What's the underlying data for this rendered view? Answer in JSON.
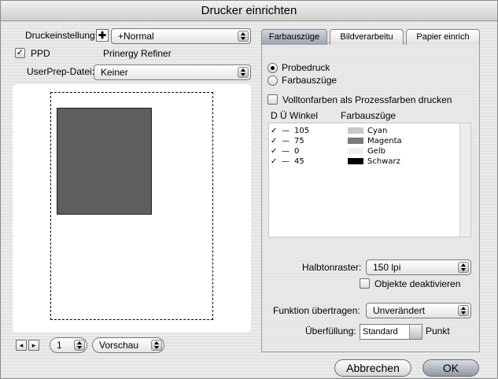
{
  "window": {
    "title": "Drucker einrichten"
  },
  "left": {
    "preset_label": "Druckeinstellung:",
    "preset_value": "+Normal",
    "ppd_label": "PPD",
    "ppd_value": "Prinergy Refiner",
    "userprep_label": "UserPrep-Datei:",
    "userprep_value": "Keiner",
    "page_value": "1",
    "view_value": "Vorschau"
  },
  "tabs": [
    {
      "label": "Farbauszüge"
    },
    {
      "label": "Bildverarbeitu"
    },
    {
      "label": "Papier einrich"
    }
  ],
  "separation": {
    "radio_proof": "Probedruck",
    "radio_sep": "Farbauszüge",
    "spot_checkbox": "Volltonfarben als Prozessfarben drucken",
    "col_headers": "D  Ü  Winkel",
    "col_sep": "Farbauszüge",
    "rows": [
      {
        "check": "✓",
        "dash": "—",
        "angle": "105",
        "name": "Cyan",
        "color": "#c8c8c8"
      },
      {
        "check": "✓",
        "dash": "—",
        "angle": "75",
        "name": "Magenta",
        "color": "#7a7a7a"
      },
      {
        "check": "✓",
        "dash": "—",
        "angle": "0",
        "name": "Gelb",
        "color": "#efefef"
      },
      {
        "check": "✓",
        "dash": "—",
        "angle": "45",
        "name": "Schwarz",
        "color": "#000000"
      }
    ],
    "halftone_label": "Halbtonraster:",
    "halftone_value": "150 lpi",
    "disable_objects": "Objekte deaktivieren",
    "transfer_label": "Funktion übertragen:",
    "transfer_value": "Unverändert",
    "trap_label": "Überfüllung:",
    "trap_value": "Standard",
    "trap_unit": "Punkt"
  },
  "buttons": {
    "cancel": "Abbrechen",
    "ok": "OK"
  }
}
